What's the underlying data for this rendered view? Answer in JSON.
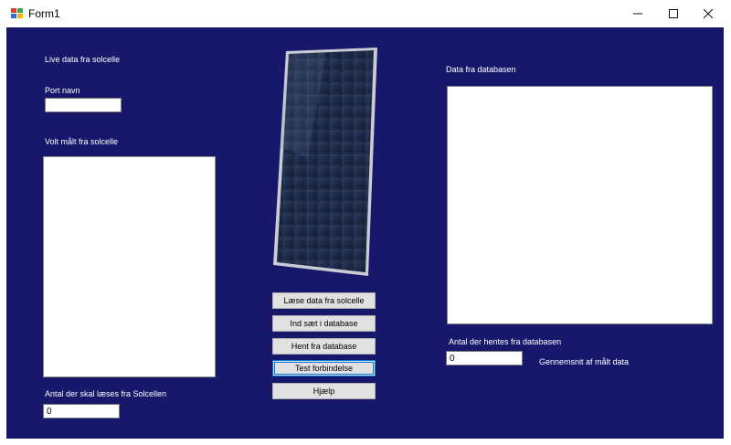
{
  "window": {
    "title": "Form1",
    "icon": "winforms-app-icon",
    "minimize_glyph": "—",
    "maximize_glyph": "☐",
    "close_glyph": "✕"
  },
  "labels": {
    "live_data": "Live data fra solcelle",
    "port_name": "Port navn",
    "volt_measured": "Volt målt fra solcelle",
    "count_read": "Antal der skal læses fra Solcellen",
    "data_from_db": "Data fra databasen",
    "count_fetch": "Antal der hentes fra databasen",
    "average": "Gennemsnit af målt data"
  },
  "inputs": {
    "port_name_value": "",
    "count_read_value": "0",
    "count_fetch_value": "0"
  },
  "buttons": {
    "read_data": "Læse data fra solcelle",
    "insert_db": "Ind sæt i database",
    "fetch_db": "Hent fra database",
    "test_connection": "Test forbindelse",
    "help": "Hjælp"
  },
  "image": {
    "subject": "solar-panel"
  },
  "colors": {
    "background": "#17176b",
    "text": "#ffffff"
  }
}
